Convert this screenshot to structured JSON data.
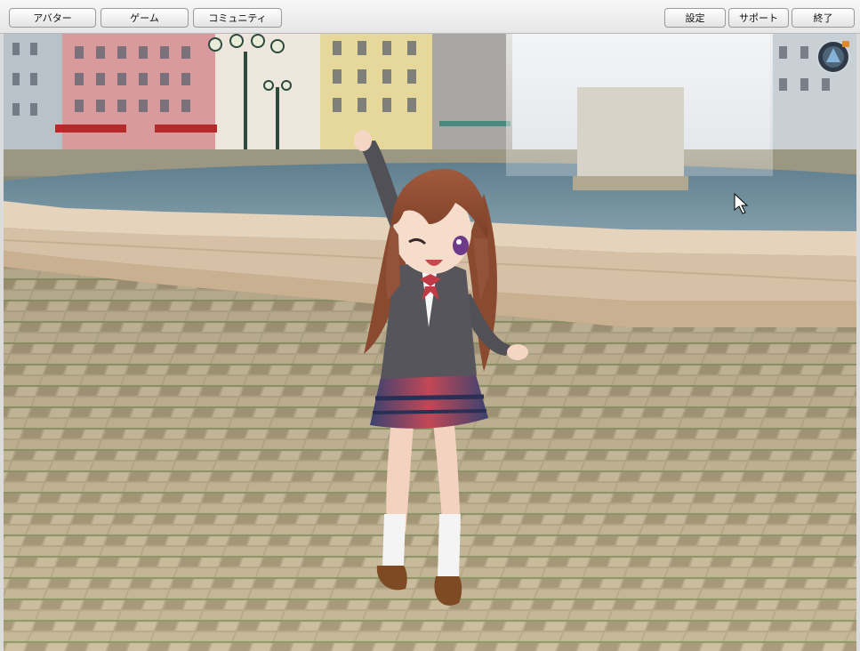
{
  "toolbar": {
    "left_buttons": [
      "アバター",
      "ゲーム",
      "コミュニティ"
    ],
    "right_buttons": [
      "設定",
      "サポート",
      "終了"
    ]
  },
  "scene": {
    "character": "school-uniform-girl-avatar",
    "location": "plaza-fountain",
    "compass_icon": "compass-icon",
    "cursor_icon": "mouse-cursor-icon"
  }
}
